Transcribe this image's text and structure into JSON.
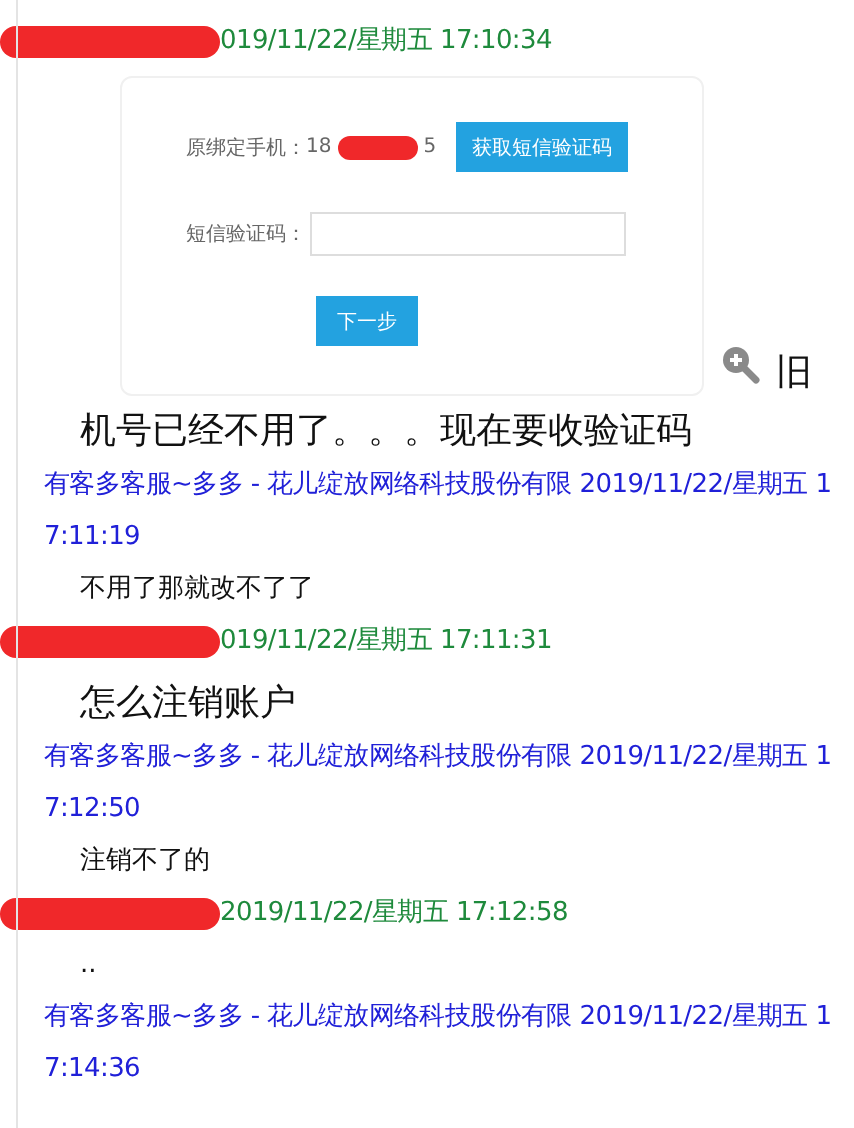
{
  "messages": [
    {
      "kind": "header_self",
      "redacted": true,
      "time": "019/11/22/星期五 17:10:34"
    },
    {
      "kind": "image",
      "phone_label": "原绑定手机：",
      "phone_start": "18",
      "phone_end": "5",
      "sms_button": "获取短信验证码",
      "code_label": "短信验证码：",
      "next_button": "下一步",
      "trailing": "旧"
    },
    {
      "kind": "text_large",
      "text": "机号已经不用了。。。现在要收验证码"
    },
    {
      "kind": "header_agent",
      "redacted": false,
      "time": "有客多客服~多多 - 花儿绽放网络科技股份有限 2019/11/22/星期五 17:11:19"
    },
    {
      "kind": "text_small",
      "text": "不用了那就改不了了"
    },
    {
      "kind": "header_self",
      "redacted": true,
      "time": "019/11/22/星期五 17:11:31"
    },
    {
      "kind": "text_large",
      "text": "怎么注销账户"
    },
    {
      "kind": "header_agent",
      "redacted": false,
      "time": "有客多客服~多多 - 花儿绽放网络科技股份有限 2019/11/22/星期五 17:12:50"
    },
    {
      "kind": "text_small",
      "text": "注销不了的"
    },
    {
      "kind": "header_self",
      "redacted": true,
      "time": "2019/11/22/星期五 17:12:58"
    },
    {
      "kind": "text_small",
      "text": ".."
    },
    {
      "kind": "header_agent",
      "redacted": false,
      "time": "有客多客服~多多 - 花儿绽放网络科技股份有限 2019/11/22/星期五 17:14:36"
    }
  ]
}
